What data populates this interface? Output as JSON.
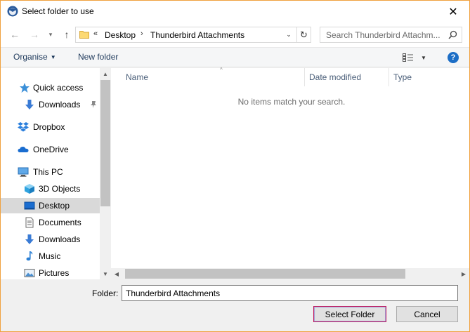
{
  "window": {
    "title": "Select folder to use",
    "close_glyph": "✕"
  },
  "navigation": {
    "back_glyph": "←",
    "forward_glyph": "→",
    "recent_glyph": "▾",
    "up_glyph": "↑"
  },
  "address": {
    "more_glyph": "«",
    "crumbs": [
      "Desktop",
      "Thunderbird Attachments"
    ],
    "separator_glyph": "›",
    "dropdown_glyph": "⌄",
    "refresh_glyph": "↻"
  },
  "search": {
    "placeholder": "Search Thunderbird Attachm..."
  },
  "toolbar": {
    "organise_label": "Organise",
    "new_folder_label": "New folder",
    "help_label": "?"
  },
  "nav_pane": {
    "items": [
      {
        "label": "Quick access",
        "icon": "star-icon"
      },
      {
        "label": "Downloads",
        "icon": "download-arrow-icon",
        "pinned": true
      },
      {
        "label": "Dropbox",
        "icon": "dropbox-icon"
      },
      {
        "label": "OneDrive",
        "icon": "cloud-icon"
      },
      {
        "label": "This PC",
        "icon": "computer-icon"
      },
      {
        "label": "3D Objects",
        "icon": "cube-icon"
      },
      {
        "label": "Desktop",
        "icon": "desktop-icon",
        "selected": true
      },
      {
        "label": "Documents",
        "icon": "document-icon"
      },
      {
        "label": "Downloads",
        "icon": "download-arrow-icon"
      },
      {
        "label": "Music",
        "icon": "music-note-icon"
      },
      {
        "label": "Pictures",
        "icon": "picture-icon"
      }
    ]
  },
  "content": {
    "columns": [
      "Name",
      "Date modified",
      "Type"
    ],
    "empty_message": "No items match your search."
  },
  "footer": {
    "folder_label": "Folder:",
    "folder_value": "Thunderbird Attachments",
    "select_button": "Select Folder",
    "cancel_button": "Cancel"
  },
  "colors": {
    "window_border": "#f0a13e",
    "selected_item": "#d9d9d9",
    "link_text": "#1e395b",
    "help_blue": "#1c6ec6",
    "primary_button_border": "#c2185b"
  }
}
